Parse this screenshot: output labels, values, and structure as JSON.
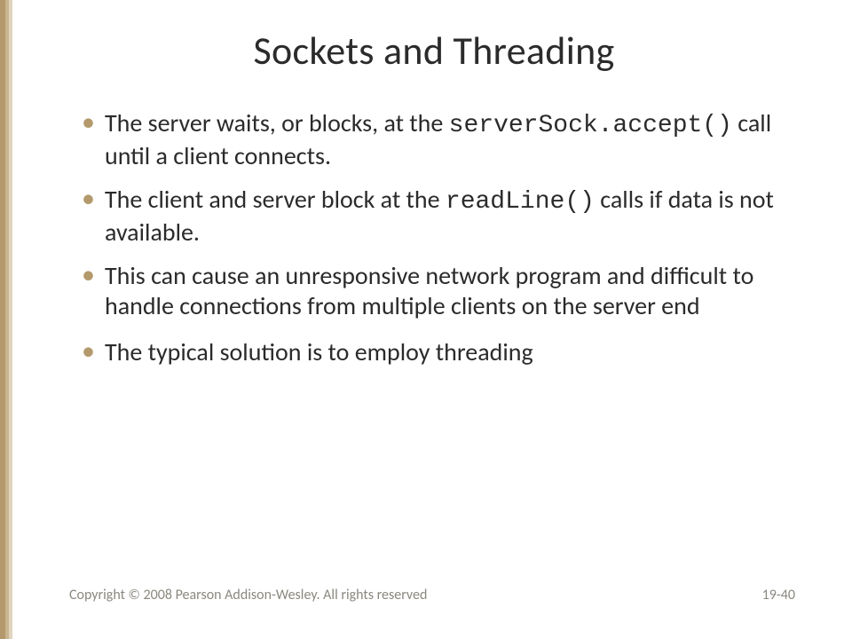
{
  "title": "Sockets and Threading",
  "bullets": [
    {
      "pre": "The server waits, or blocks, at the ",
      "code": "serverSock.accept()",
      "post": " call until a client connects."
    },
    {
      "pre": "The client and server block at the ",
      "code": "readLine()",
      "post": " calls if data is not available."
    },
    {
      "pre": "This can cause an unresponsive network program and difficult to handle connections from multiple clients on the server end",
      "code": "",
      "post": ""
    },
    {
      "pre": "The typical solution is to employ threading",
      "code": "",
      "post": ""
    }
  ],
  "copyright": "Copyright © 2008 Pearson Addison-Wesley. All rights reserved",
  "page_number": "19-40"
}
